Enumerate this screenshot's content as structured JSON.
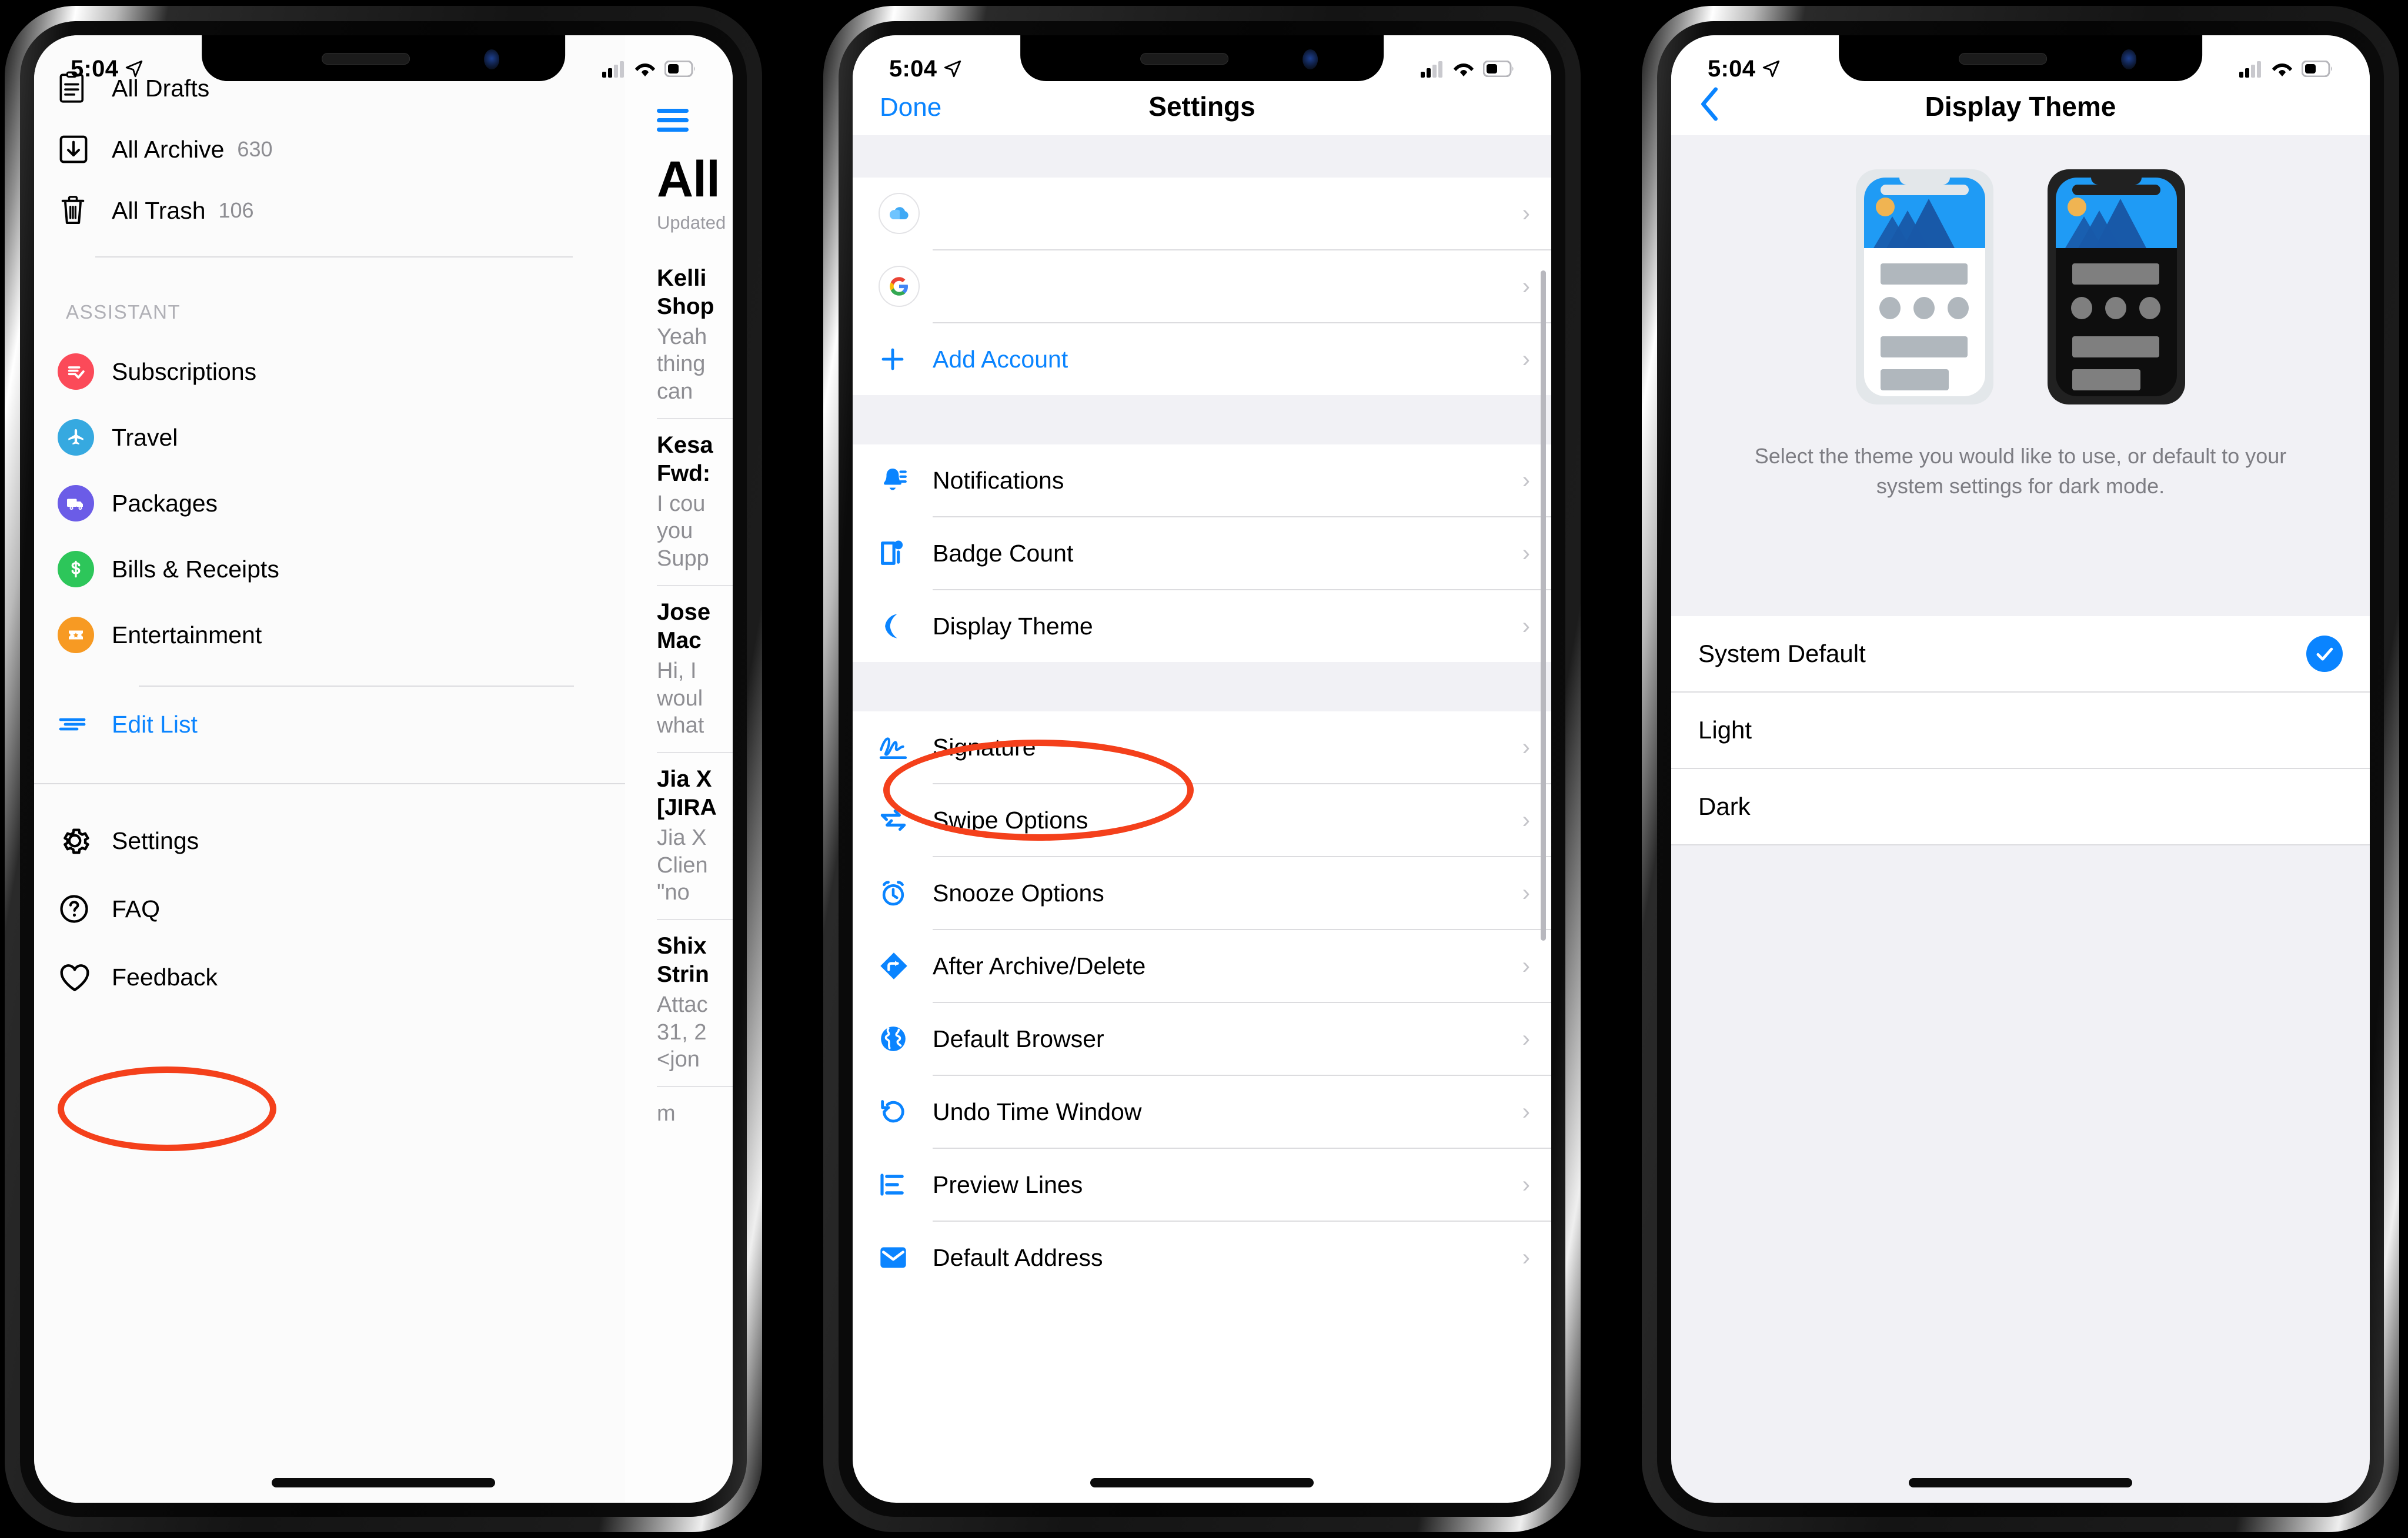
{
  "statusbar": {
    "time": "5:04",
    "location_icon": "location-arrow",
    "signal": "cellular-bars",
    "wifi": "wifi-icon",
    "battery": "battery-icon"
  },
  "phone1": {
    "mailboxes": [
      {
        "label": "All Drafts",
        "count": "",
        "icon": "drafts-icon"
      },
      {
        "label": "All Archive",
        "count": "630",
        "icon": "archive-icon"
      },
      {
        "label": "All Trash",
        "count": "106",
        "icon": "trash-icon"
      }
    ],
    "assistant_header": "ASSISTANT",
    "assistant": [
      {
        "label": "Subscriptions",
        "icon": "subscriptions-icon",
        "color": "#fb4a59"
      },
      {
        "label": "Travel",
        "icon": "airplane-icon",
        "color": "#36a9e0"
      },
      {
        "label": "Packages",
        "icon": "truck-icon",
        "color": "#6b5ce7"
      },
      {
        "label": "Bills & Receipts",
        "icon": "dollar-icon",
        "color": "#2dc65a"
      },
      {
        "label": "Entertainment",
        "icon": "ticket-icon",
        "color": "#f79a23"
      }
    ],
    "edit_list": {
      "label": "Edit List",
      "icon": "edit-list-icon",
      "color": "#0a84ff"
    },
    "footer": [
      {
        "label": "Settings",
        "icon": "gear-icon"
      },
      {
        "label": "FAQ",
        "icon": "question-circle-icon"
      },
      {
        "label": "Feedback",
        "icon": "heart-icon"
      }
    ],
    "maillist": {
      "menu_icon": "hamburger-icon",
      "title": "All",
      "subtitle": "Updated",
      "items": [
        {
          "from": "Kelli",
          "subject": "Shop",
          "preview": "Yeah\nthing\ncan "
        },
        {
          "from": "Kesa",
          "subject": "Fwd:",
          "preview": "I cou\nyou \nSupp"
        },
        {
          "from": "Jose",
          "subject": "Mac",
          "preview": "Hi, I\nwoul\nwhat"
        },
        {
          "from": "Jia X",
          "subject": "[JIRA",
          "preview": "Jia X\nClien\n\"no "
        },
        {
          "from": "Shix",
          "subject": "Strin",
          "preview": "Attac\n31, 2\n<jon"
        }
      ]
    },
    "annotation": {
      "target": "Settings",
      "color": "#f4401b"
    }
  },
  "phone2": {
    "nav": {
      "left_button": "Done",
      "title": "Settings"
    },
    "accounts": [
      {
        "label": "",
        "icon": "icloud-icon"
      },
      {
        "label": "",
        "icon": "google-icon"
      },
      {
        "label": "Add Account",
        "icon": "plus-icon",
        "accent": "#0a84ff"
      }
    ],
    "group1": [
      {
        "label": "Notifications",
        "icon": "bell-icon"
      },
      {
        "label": "Badge Count",
        "icon": "badge-count-icon"
      },
      {
        "label": "Display Theme",
        "icon": "moon-icon"
      }
    ],
    "group2": [
      {
        "label": "Signature",
        "icon": "signature-icon"
      },
      {
        "label": "Swipe Options",
        "icon": "swipe-icon"
      },
      {
        "label": "Snooze Options",
        "icon": "alarm-clock-icon"
      },
      {
        "label": "After Archive/Delete",
        "icon": "after-archive-icon"
      },
      {
        "label": "Default Browser",
        "icon": "globe-icon"
      },
      {
        "label": "Undo Time Window",
        "icon": "undo-icon"
      },
      {
        "label": "Preview Lines",
        "icon": "preview-lines-icon"
      },
      {
        "label": "Default Address",
        "icon": "envelope-icon"
      }
    ],
    "accent": "#0a84ff",
    "annotation": {
      "target": "Display Theme",
      "color": "#f4401b"
    }
  },
  "phone3": {
    "nav": {
      "back_icon": "chevron-left-icon",
      "title": "Display Theme"
    },
    "preview": {
      "light_label": "light-theme-preview",
      "dark_label": "dark-theme-preview",
      "sky_color": "#1f9bf5",
      "sun_color": "#f0b452",
      "mountain_color": "#1859a8"
    },
    "description": "Select the theme you would like to use, or default to your system settings for dark mode.",
    "options": [
      {
        "label": "System Default",
        "selected": true
      },
      {
        "label": "Light",
        "selected": false
      },
      {
        "label": "Dark",
        "selected": false
      }
    ],
    "accent": "#0a84ff"
  }
}
